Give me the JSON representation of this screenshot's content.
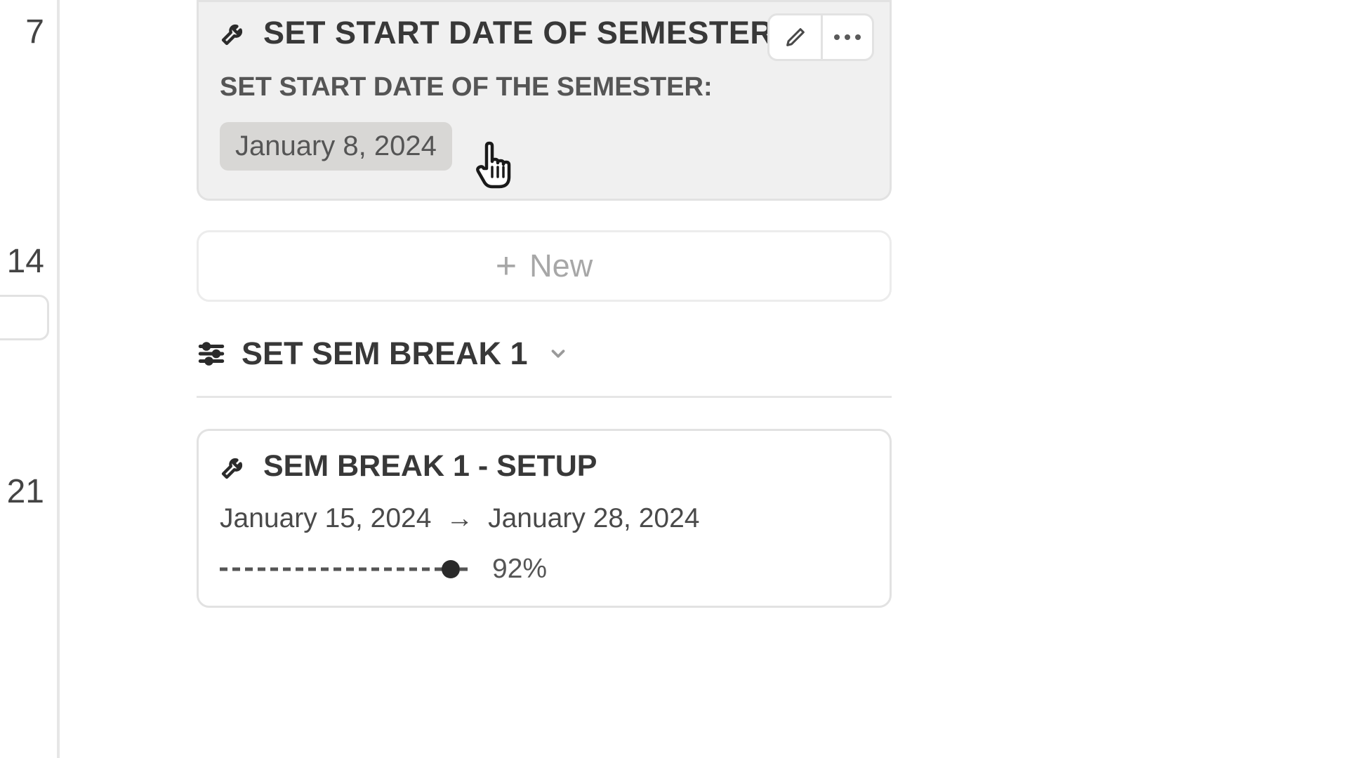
{
  "gutter": {
    "dates": [
      "7",
      "14",
      "21"
    ]
  },
  "card1": {
    "title": "SET START DATE OF SEMESTER",
    "subtitle": "SET START DATE OF THE SEMESTER:",
    "date_value": "January 8, 2024"
  },
  "newrow": {
    "label": "New"
  },
  "section": {
    "title": "SET SEM BREAK 1"
  },
  "card2": {
    "title": "SEM BREAK 1 - SETUP",
    "date_start": "January 15, 2024",
    "date_end": "January 28, 2024",
    "progress_pct": "92%",
    "progress_value": 92
  }
}
